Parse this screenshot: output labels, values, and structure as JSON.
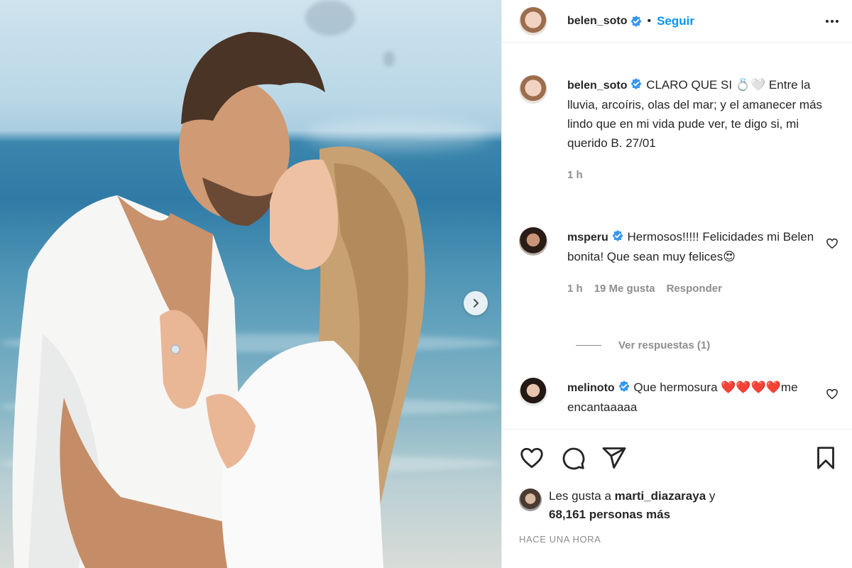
{
  "header": {
    "username": "belen_soto",
    "follow_label": "Seguir"
  },
  "caption": {
    "username": "belen_soto",
    "text": "CLARO QUE SI 💍🤍",
    "body": "Entre la lluvia, arcoíris, olas del mar; y el amanecer más lindo que en mi vida pude ver, te digo si, mi querido B. 27/01",
    "time": "1 h"
  },
  "comments": [
    {
      "username": "msperu",
      "text": "Hermosos!!!!! Felicidades mi Belen bonita! Que sean muy felices😍",
      "time": "1 h",
      "likes": "19 Me gusta",
      "reply_label": "Responder"
    },
    {
      "username": "melinoto",
      "text": "Que hermosura ❤️❤️❤️❤️me encantaaaaa"
    }
  ],
  "replies_label": "Ver respuestas (1)",
  "likes": {
    "prefix": "Les gusta a",
    "user": "marti_diazaraya",
    "joiner": "y",
    "count": "68,161 personas más"
  },
  "timestamp": "HACE UNA HORA",
  "icons": {
    "like": "heart-icon",
    "comment": "comment-icon",
    "share": "share-icon",
    "save": "bookmark-icon",
    "more": "more-icon",
    "next": "chevron-right-icon",
    "verified": "verified-icon"
  },
  "colors": {
    "accent": "#0095f6",
    "text": "#262626",
    "muted": "#8e8e8e",
    "verified": "#3897f0"
  }
}
